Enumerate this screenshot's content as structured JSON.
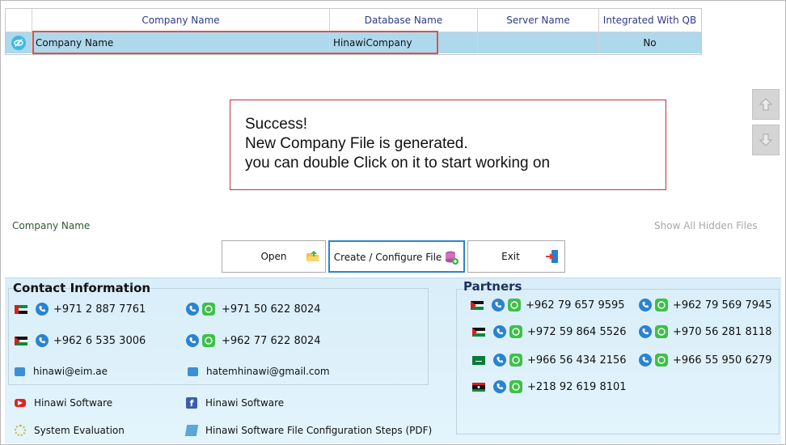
{
  "grid": {
    "columns": [
      "Company Name",
      "Database Name",
      "Server Name",
      "Integrated With QB"
    ],
    "row": {
      "company_name": "Company Name",
      "database_name": "HinawiCompany",
      "server_name": "",
      "integrated": "No"
    }
  },
  "message": {
    "line1": "Success!",
    "line2": "New Company File is generated.",
    "line3": "you can double Click on it to start working on"
  },
  "labels": {
    "company_name": "Company Name",
    "show_hidden": "Show All Hidden Files"
  },
  "buttons": {
    "open": "Open",
    "create": "Create / Configure File",
    "exit": "Exit"
  },
  "contact": {
    "title": "Contact Information",
    "phone1": "+971 2 887 7761",
    "phone2": "+971 50 622 8024",
    "phone3": "+962 6 535 3006",
    "phone4": "+962 77 622 8024",
    "email1": "hinawi@eim.ae",
    "email2": "hatemhinawi@gmail.com",
    "youtube": "Hinawi Software",
    "facebook": "Hinawi Software",
    "evaluation": "System Evaluation",
    "steps": "Hinawi Software File Configuration Steps (PDF)"
  },
  "partners": {
    "title": "Partners",
    "p1": "+962 79 657 9595",
    "p2": "+962 79 569 7945",
    "p3": "+972 59 864 5526",
    "p4": "+970 56 281 8118",
    "p5": "+966 56 434 2156",
    "p6": "+966 55 950 6279",
    "p7": "+218 92 619 8101"
  },
  "colors": {
    "accent": "#aed8ec",
    "highlight": "#d9534f",
    "phone": "#2a83d0",
    "whatsapp": "#3fbf4a"
  }
}
